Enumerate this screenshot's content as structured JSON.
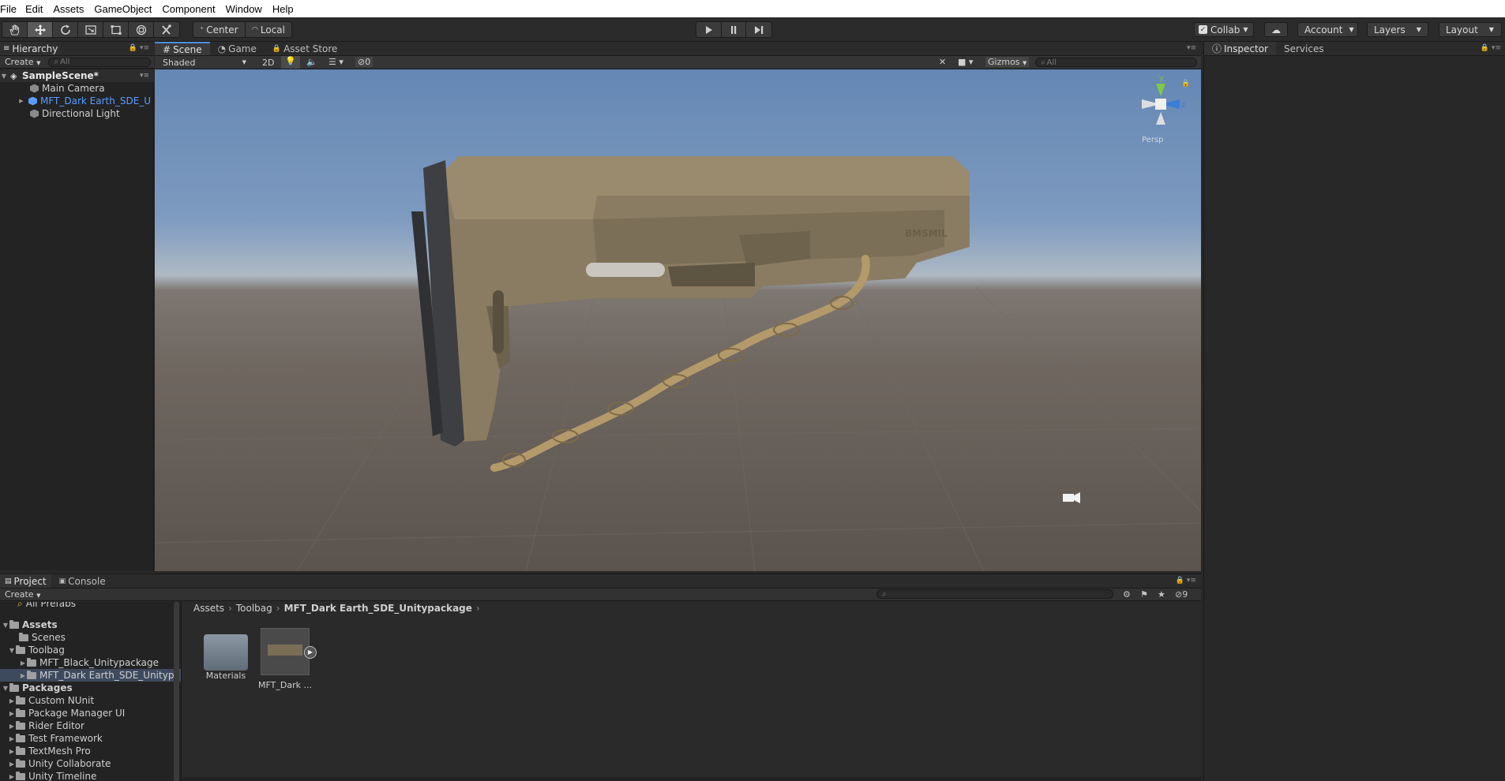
{
  "menu": [
    "File",
    "Edit",
    "Assets",
    "GameObject",
    "Component",
    "Window",
    "Help"
  ],
  "toolbar": {
    "tools": [
      "hand-icon",
      "move-icon",
      "rotate-icon",
      "scale-icon",
      "rect-icon",
      "transform-icon",
      "custom-tool-icon"
    ],
    "pivot": "Center",
    "space": "Local",
    "collab": "Collab",
    "account": "Account",
    "layers": "Layers",
    "layout": "Layout"
  },
  "hierarchy": {
    "tab": "Hierarchy",
    "create": "Create",
    "search_placeholder": "All",
    "scene_name": "SampleScene*",
    "items": [
      "Main Camera",
      "MFT_Dark Earth_SDE_U",
      "Directional Light"
    ]
  },
  "scene": {
    "tabs": [
      "Scene",
      "Game",
      "Asset Store"
    ],
    "shading": "Shaded",
    "mode2d": "2D",
    "hidden_count": "0",
    "gizmos": "Gizmos",
    "search_placeholder": "All",
    "persp_label": "Persp",
    "axis_y": "y",
    "axis_z": "z"
  },
  "inspector": {
    "tabs": [
      "Inspector",
      "Services"
    ]
  },
  "project": {
    "tabs": [
      "Project",
      "Console"
    ],
    "create": "Create",
    "hidden_count": "9",
    "breadcrumb": [
      "Assets",
      "Toolbag",
      "MFT_Dark Earth_SDE_Unitypackage"
    ],
    "tree": [
      {
        "label": "All Prefabs",
        "level": 1,
        "type": "search",
        "arrow": ""
      },
      {
        "label": "Assets",
        "level": 0,
        "type": "folder",
        "arrow": "▼",
        "bold": true
      },
      {
        "label": "Scenes",
        "level": 1,
        "type": "folder",
        "arrow": ""
      },
      {
        "label": "Toolbag",
        "level": 1,
        "type": "folder",
        "arrow": "▼"
      },
      {
        "label": "MFT_Black_Unitypackage",
        "level": 2,
        "type": "folder",
        "arrow": "▶"
      },
      {
        "label": "MFT_Dark Earth_SDE_Unitypa",
        "level": 2,
        "type": "folder",
        "arrow": "▶",
        "selected": true
      },
      {
        "label": "Packages",
        "level": 0,
        "type": "folder",
        "arrow": "▼",
        "bold": true
      },
      {
        "label": "Custom NUnit",
        "level": 1,
        "type": "folder",
        "arrow": "▶"
      },
      {
        "label": "Package Manager UI",
        "level": 1,
        "type": "folder",
        "arrow": "▶"
      },
      {
        "label": "Rider Editor",
        "level": 1,
        "type": "folder",
        "arrow": "▶"
      },
      {
        "label": "Test Framework",
        "level": 1,
        "type": "folder",
        "arrow": "▶"
      },
      {
        "label": "TextMesh Pro",
        "level": 1,
        "type": "folder",
        "arrow": "▶"
      },
      {
        "label": "Unity Collaborate",
        "level": 1,
        "type": "folder",
        "arrow": "▶"
      },
      {
        "label": "Unity Timeline",
        "level": 1,
        "type": "folder",
        "arrow": "▶"
      }
    ],
    "assets": [
      "Materials",
      "MFT_Dark ..."
    ]
  },
  "colors": {
    "selection_blue": "#5b9cff",
    "tab_highlight": "#4d8fe0",
    "stock_tan": "#8e8066",
    "rope": "#b49a6a"
  }
}
